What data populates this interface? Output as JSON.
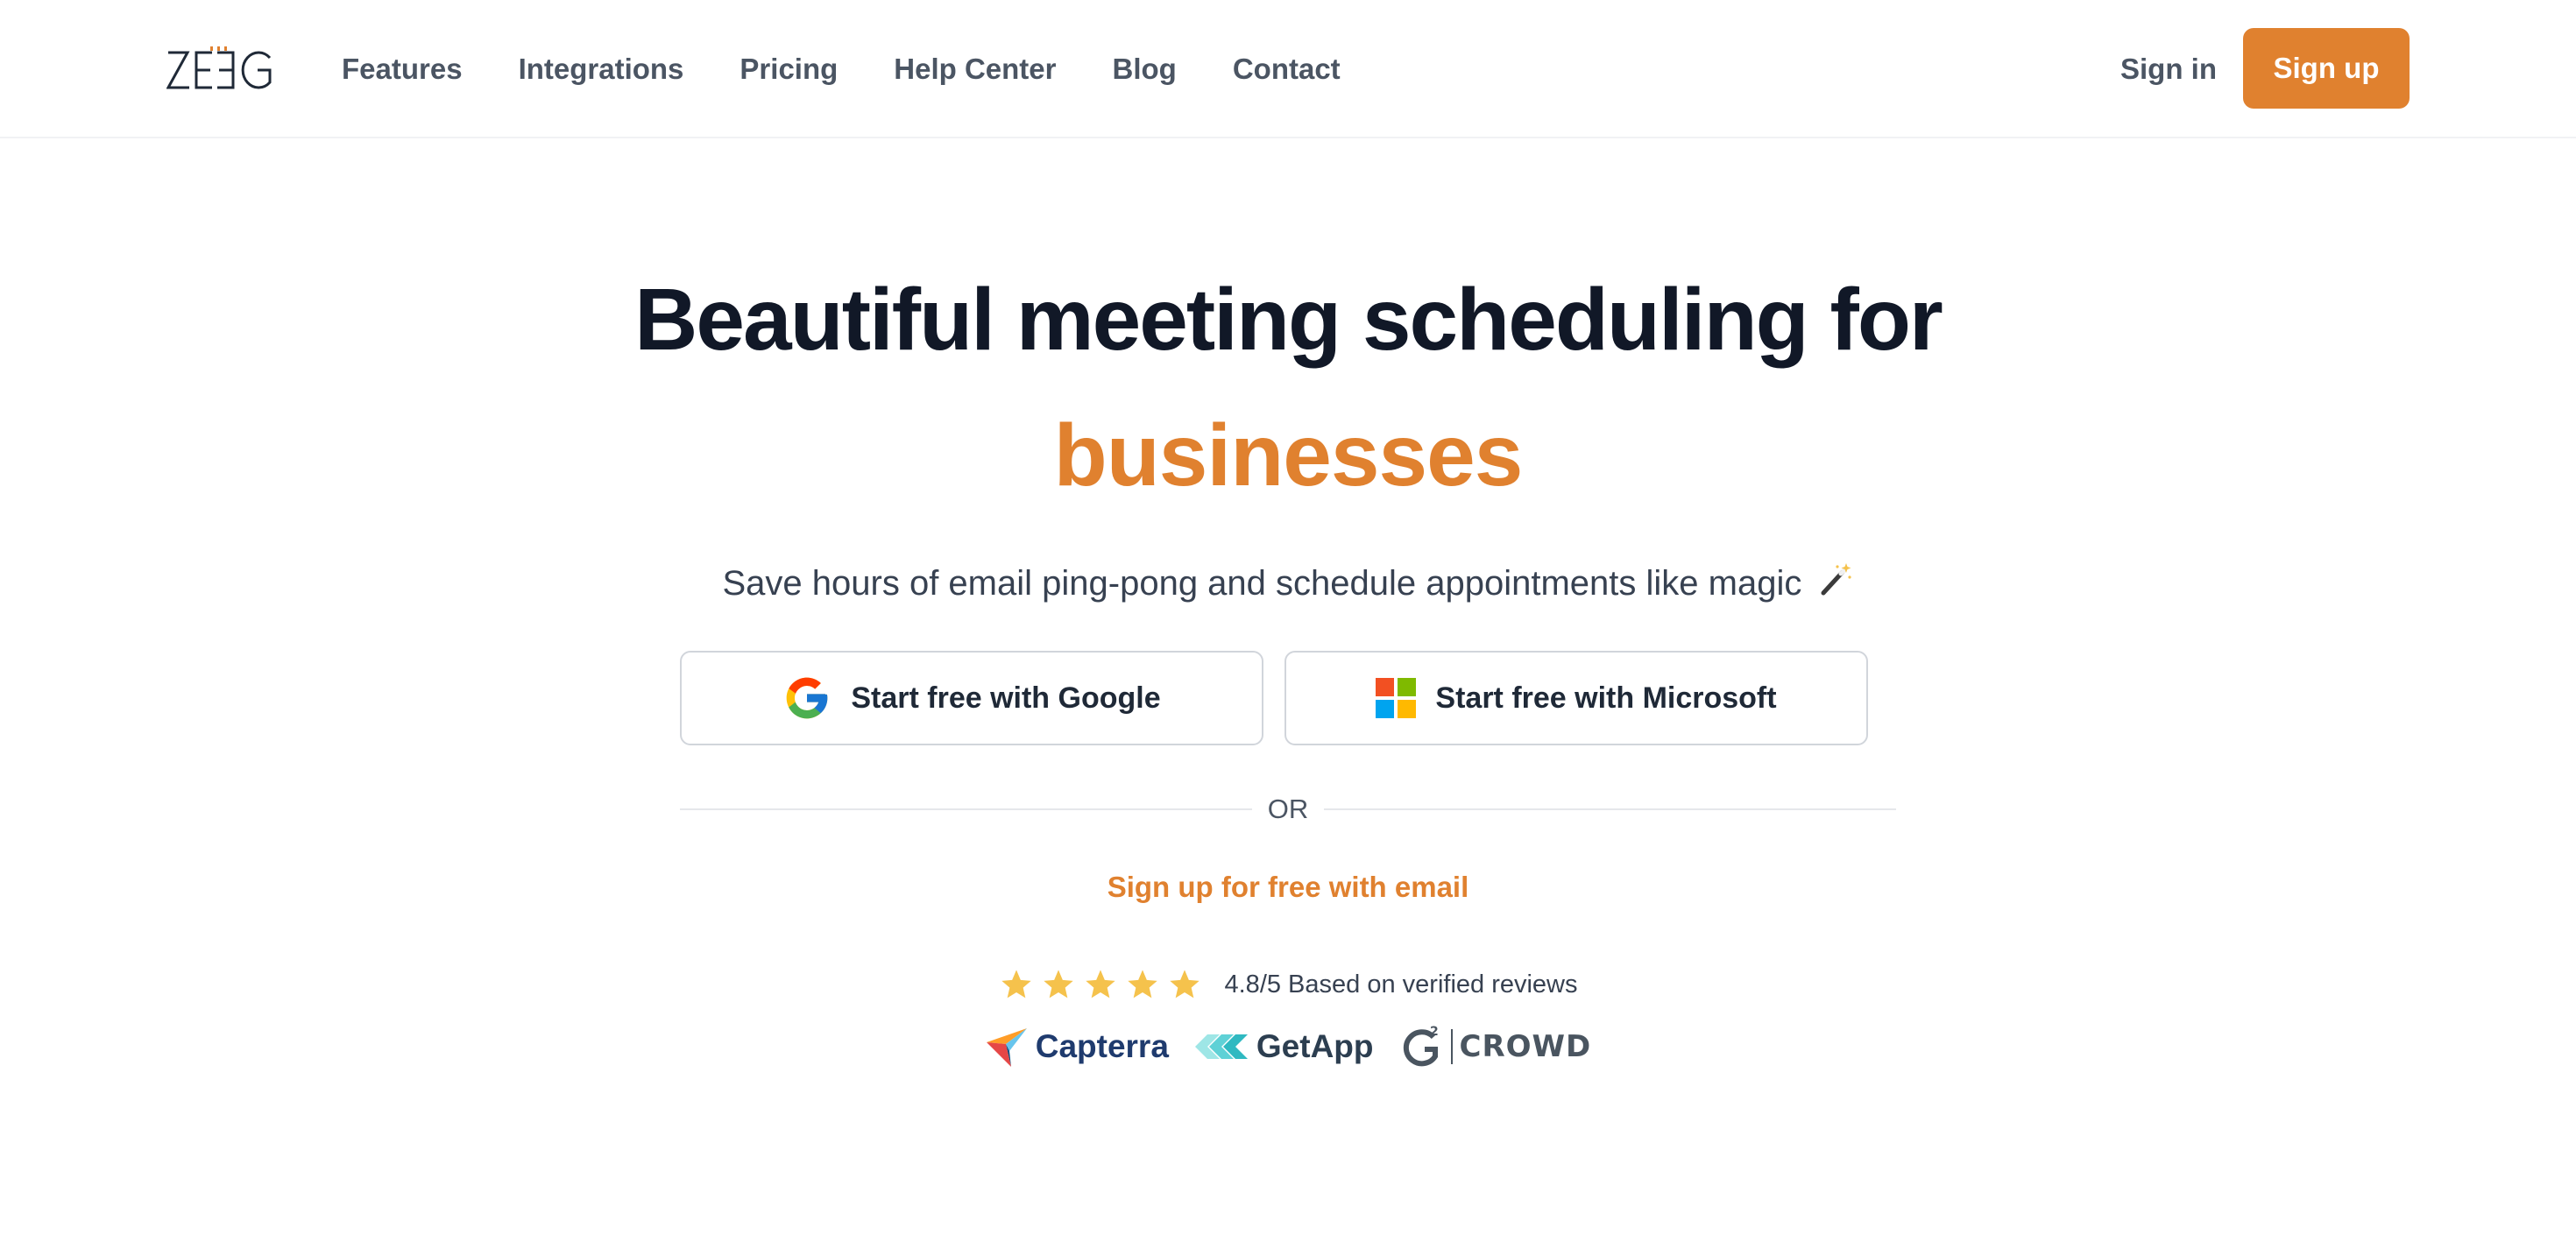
{
  "header": {
    "logo_text": "ZEEG",
    "nav": [
      "Features",
      "Integrations",
      "Pricing",
      "Help Center",
      "Blog",
      "Contact"
    ],
    "signin_label": "Sign in",
    "signup_label": "Sign up"
  },
  "hero": {
    "title": "Beautiful meeting scheduling for",
    "title_accent": "businesses",
    "subtitle": "Save hours of email ping-pong and schedule appointments like magic",
    "google_button": "Start free with Google",
    "microsoft_button": "Start free with Microsoft",
    "divider_text": "OR",
    "email_link": "Sign up for free with email"
  },
  "rating": {
    "stars": 5,
    "text": "4.8/5 Based on verified reviews"
  },
  "badges": {
    "capterra": "Capterra",
    "getapp": "GetApp",
    "g2_crowd": "CROWD"
  },
  "colors": {
    "accent": "#e0812f",
    "star": "#f5c24c",
    "text_dark": "#111827",
    "nav_text": "#4b5563"
  },
  "icons": {
    "wand": "magic-wand-icon",
    "google": "google-icon",
    "microsoft": "microsoft-icon",
    "star": "star-icon"
  }
}
